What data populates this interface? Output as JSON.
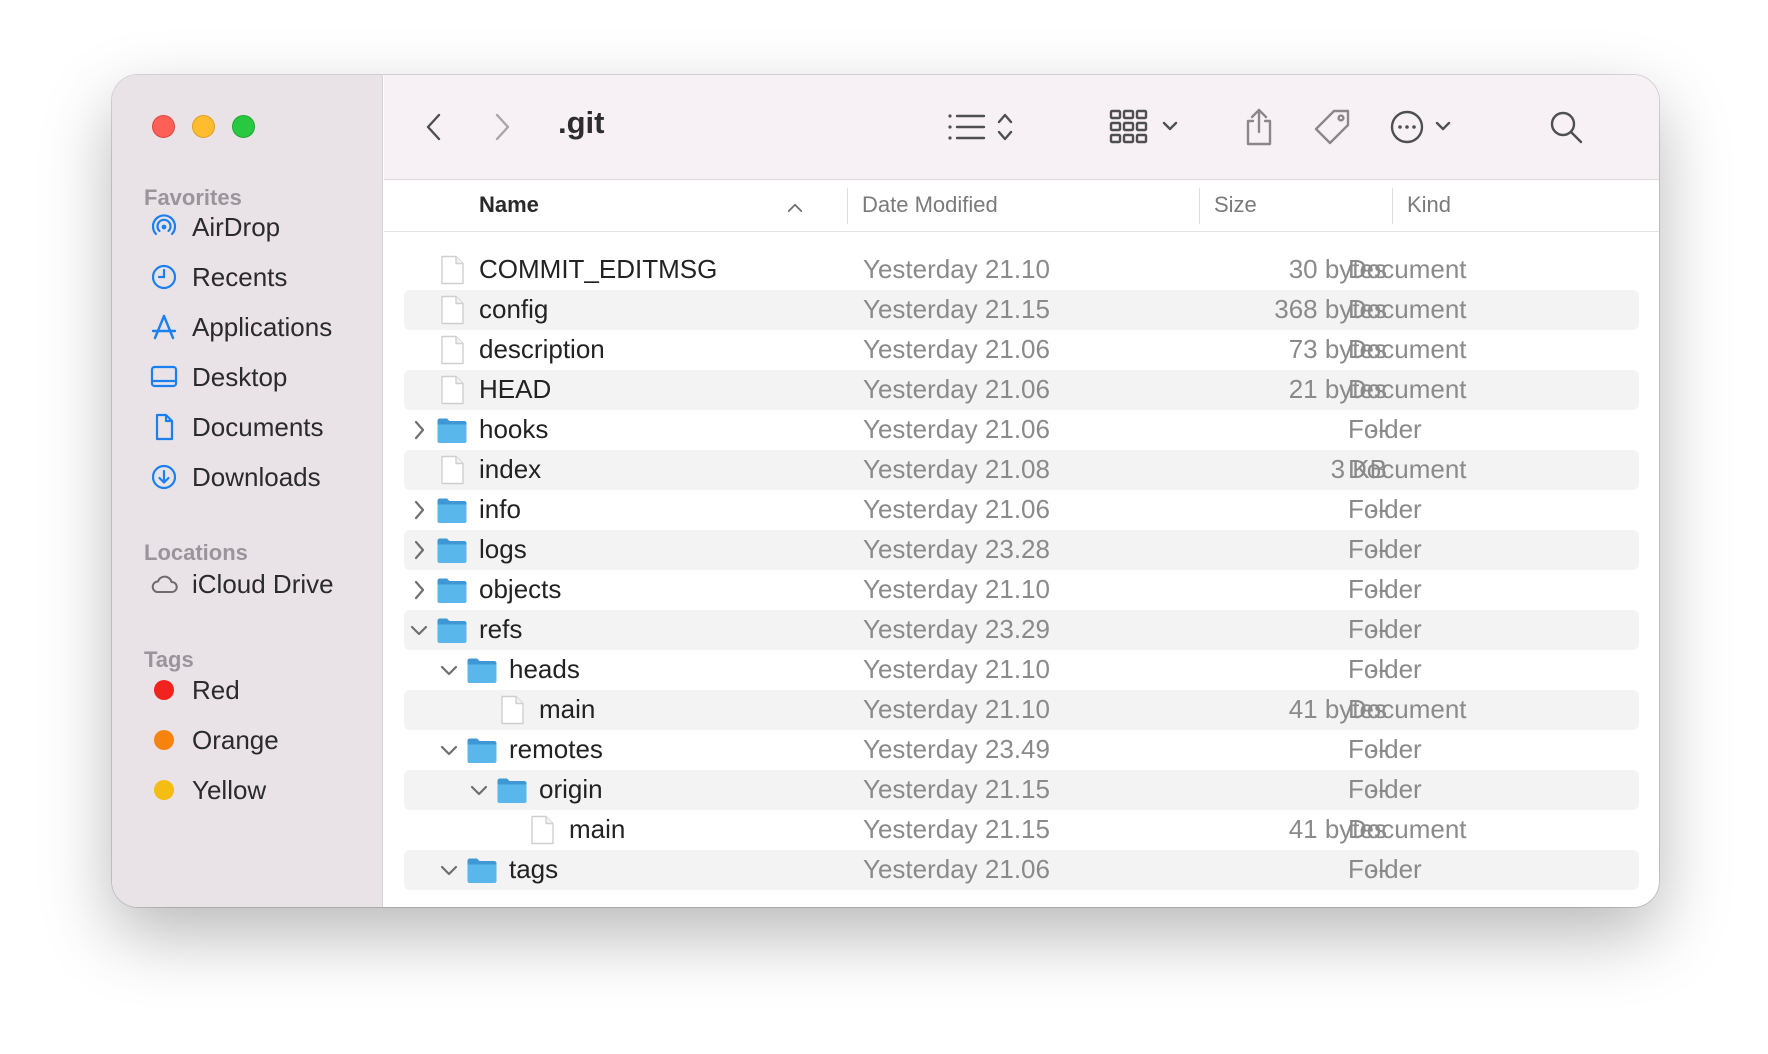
{
  "window": {
    "title": ".git"
  },
  "sidebar": {
    "favorites_label": "Favorites",
    "favorites": [
      {
        "label": "AirDrop",
        "icon": "airdrop-icon"
      },
      {
        "label": "Recents",
        "icon": "clock-icon"
      },
      {
        "label": "Applications",
        "icon": "applications-icon"
      },
      {
        "label": "Desktop",
        "icon": "desktop-icon"
      },
      {
        "label": "Documents",
        "icon": "document-icon"
      },
      {
        "label": "Downloads",
        "icon": "download-icon"
      }
    ],
    "locations_label": "Locations",
    "locations": [
      {
        "label": "iCloud Drive",
        "icon": "cloud-icon"
      }
    ],
    "tags_label": "Tags",
    "tags": [
      {
        "label": "Red",
        "color": "#f2231f"
      },
      {
        "label": "Orange",
        "color": "#f7830f"
      },
      {
        "label": "Yellow",
        "color": "#f5bd12"
      }
    ]
  },
  "columns": {
    "name": "Name",
    "date": "Date Modified",
    "size": "Size",
    "kind": "Kind"
  },
  "colors": {
    "accent": "#1a7ff0",
    "folder": "#5ab7ec"
  },
  "files": [
    {
      "name": "COMMIT_EDITMSG",
      "date": "Yesterday 21.10",
      "size": "30 bytes",
      "kind": "Document",
      "type": "file",
      "depth": 0
    },
    {
      "name": "config",
      "date": "Yesterday 21.15",
      "size": "368 bytes",
      "kind": "Document",
      "type": "file",
      "depth": 0
    },
    {
      "name": "description",
      "date": "Yesterday 21.06",
      "size": "73 bytes",
      "kind": "Document",
      "type": "file",
      "depth": 0
    },
    {
      "name": "HEAD",
      "date": "Yesterday 21.06",
      "size": "21 bytes",
      "kind": "Document",
      "type": "file",
      "depth": 0
    },
    {
      "name": "hooks",
      "date": "Yesterday 21.06",
      "size": "--",
      "kind": "Folder",
      "type": "folder",
      "depth": 0,
      "expanded": false
    },
    {
      "name": "index",
      "date": "Yesterday 21.08",
      "size": "3 KB",
      "kind": "Document",
      "type": "file",
      "depth": 0
    },
    {
      "name": "info",
      "date": "Yesterday 21.06",
      "size": "--",
      "kind": "Folder",
      "type": "folder",
      "depth": 0,
      "expanded": false
    },
    {
      "name": "logs",
      "date": "Yesterday 23.28",
      "size": "--",
      "kind": "Folder",
      "type": "folder",
      "depth": 0,
      "expanded": false
    },
    {
      "name": "objects",
      "date": "Yesterday 21.10",
      "size": "--",
      "kind": "Folder",
      "type": "folder",
      "depth": 0,
      "expanded": false
    },
    {
      "name": "refs",
      "date": "Yesterday 23.29",
      "size": "--",
      "kind": "Folder",
      "type": "folder",
      "depth": 0,
      "expanded": true
    },
    {
      "name": "heads",
      "date": "Yesterday 21.10",
      "size": "--",
      "kind": "Folder",
      "type": "folder",
      "depth": 1,
      "expanded": true
    },
    {
      "name": "main",
      "date": "Yesterday 21.10",
      "size": "41 bytes",
      "kind": "Document",
      "type": "file",
      "depth": 2
    },
    {
      "name": "remotes",
      "date": "Yesterday 23.49",
      "size": "--",
      "kind": "Folder",
      "type": "folder",
      "depth": 1,
      "expanded": true
    },
    {
      "name": "origin",
      "date": "Yesterday 21.15",
      "size": "--",
      "kind": "Folder",
      "type": "folder",
      "depth": 2,
      "expanded": true
    },
    {
      "name": "main",
      "date": "Yesterday 21.15",
      "size": "41 bytes",
      "kind": "Document",
      "type": "file",
      "depth": 3
    },
    {
      "name": "tags",
      "date": "Yesterday 21.06",
      "size": "--",
      "kind": "Folder",
      "type": "folder",
      "depth": 1,
      "expanded": true
    }
  ]
}
